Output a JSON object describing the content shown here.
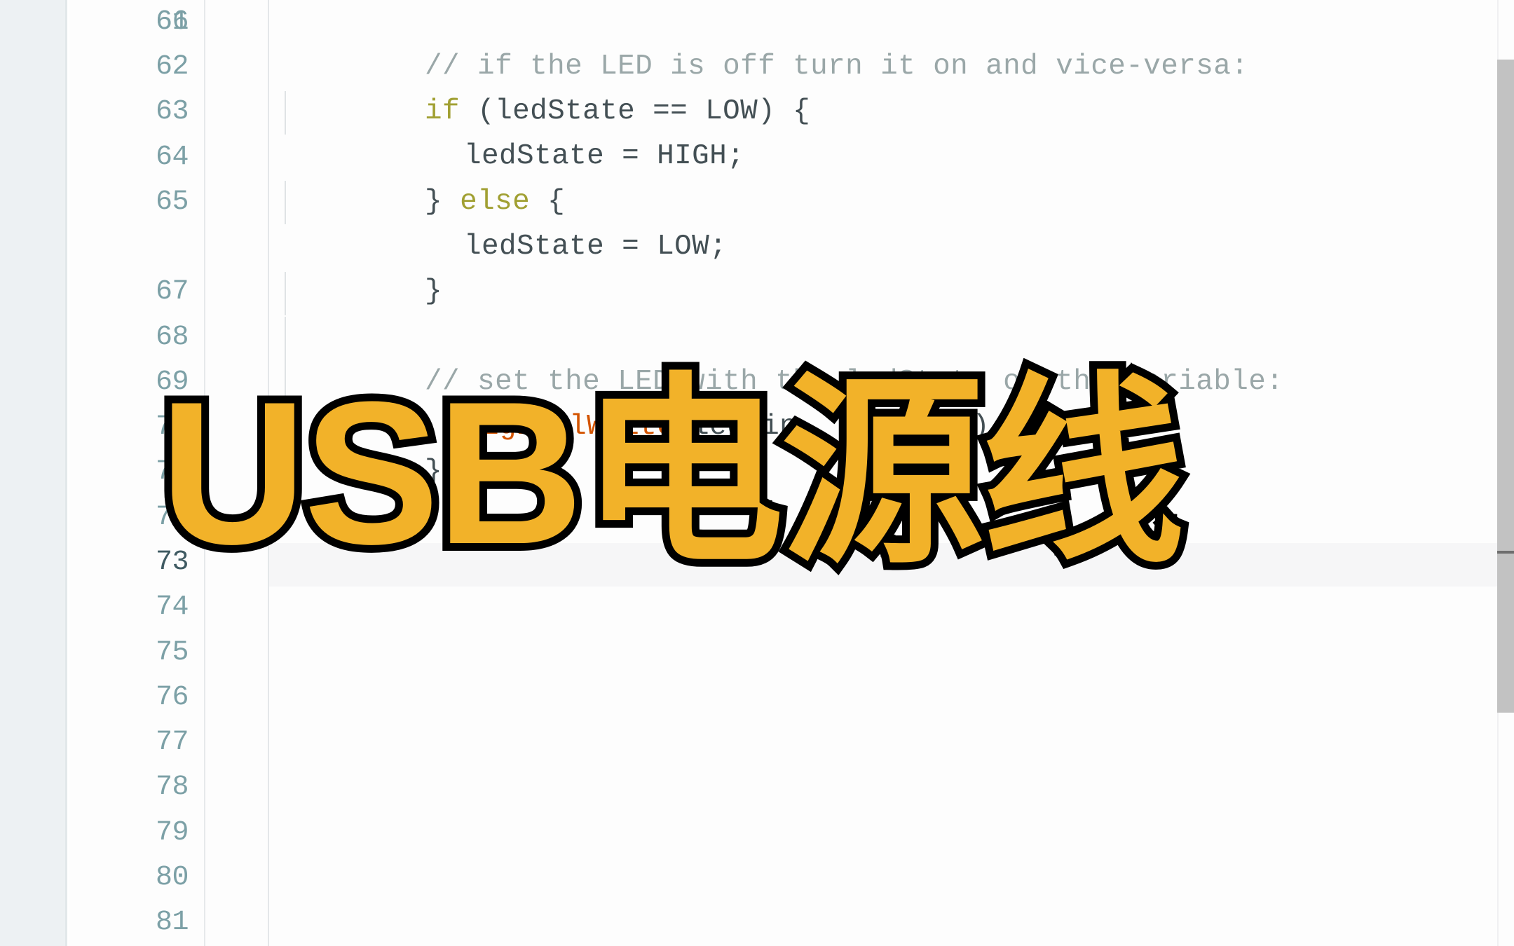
{
  "app": {
    "name": "arduino-ide-editor",
    "theme": "light"
  },
  "colors": {
    "background": "#fdfdfd",
    "left_panel": "#edf1f3",
    "gutter_number": "#7ca0a6",
    "gutter_number_current": "#3f5a62",
    "code_default": "#434f54",
    "comment": "#9aa7a8",
    "keyword": "#a1a033",
    "function": "#d35400",
    "current_line_highlight": "#f4f5f6",
    "indent_guide": "#dfe3e5",
    "scrollbar_thumb": "#c2c2c2",
    "scrollbar_mark": "#6e6e6e",
    "caption_fill": "#f2b229",
    "caption_stroke": "#000000"
  },
  "editor": {
    "first_visible_line": 61,
    "last_visible_line": 81,
    "current_line": 73,
    "lines": [
      {
        "number": "61",
        "indent": 1,
        "text": "// if the LED is off turn it on and vice-versa:",
        "kind": "comment"
      },
      {
        "number": "62",
        "indent": 1,
        "text": "if (ledState == LOW) {",
        "kind": "code"
      },
      {
        "number": "63",
        "indent": 2,
        "text": "ledState = HIGH;",
        "kind": "code"
      },
      {
        "number": "64",
        "indent": 1,
        "text": "} else {",
        "kind": "code"
      },
      {
        "number": "65",
        "indent": 2,
        "text": "ledState = LOW;",
        "kind": "code"
      },
      {
        "number": "66",
        "indent": 1,
        "text": "}",
        "kind": "code"
      },
      {
        "number": "67",
        "indent": 0,
        "text": "",
        "kind": "blank"
      },
      {
        "number": "68",
        "indent": 1,
        "text": "// set the LED with the ledState of the variable:",
        "kind": "comment"
      },
      {
        "number": "69",
        "indent": 1,
        "text": "digitalWrite(ledPin, ledState);",
        "kind": "code"
      },
      {
        "number": "70",
        "indent": 0,
        "text": "}",
        "kind": "code"
      },
      {
        "number": "71",
        "indent": 0,
        "text": "",
        "kind": "blank"
      },
      {
        "number": "72",
        "indent": 0,
        "text": "",
        "kind": "blank"
      },
      {
        "number": "73",
        "indent": 0,
        "text": "",
        "kind": "blank"
      },
      {
        "number": "74",
        "indent": 0,
        "text": "",
        "kind": "blank"
      },
      {
        "number": "75",
        "indent": 0,
        "text": "",
        "kind": "blank"
      },
      {
        "number": "76",
        "indent": 0,
        "text": "",
        "kind": "blank"
      },
      {
        "number": "77",
        "indent": 0,
        "text": "",
        "kind": "blank"
      },
      {
        "number": "78",
        "indent": 0,
        "text": "",
        "kind": "blank"
      },
      {
        "number": "79",
        "indent": 0,
        "text": "",
        "kind": "blank"
      },
      {
        "number": "80",
        "indent": 0,
        "text": "",
        "kind": "blank"
      },
      {
        "number": "81",
        "indent": 0,
        "text": "",
        "kind": "blank"
      }
    ]
  },
  "scrollbar": {
    "orientation": "vertical",
    "thumb_top_pct": 6.3,
    "thumb_height_pct": 69,
    "mark_top_pct": 58.2
  },
  "overlay_caption": {
    "text": "USB电源线",
    "language": "zh",
    "translation_hint": "USB power cable"
  }
}
